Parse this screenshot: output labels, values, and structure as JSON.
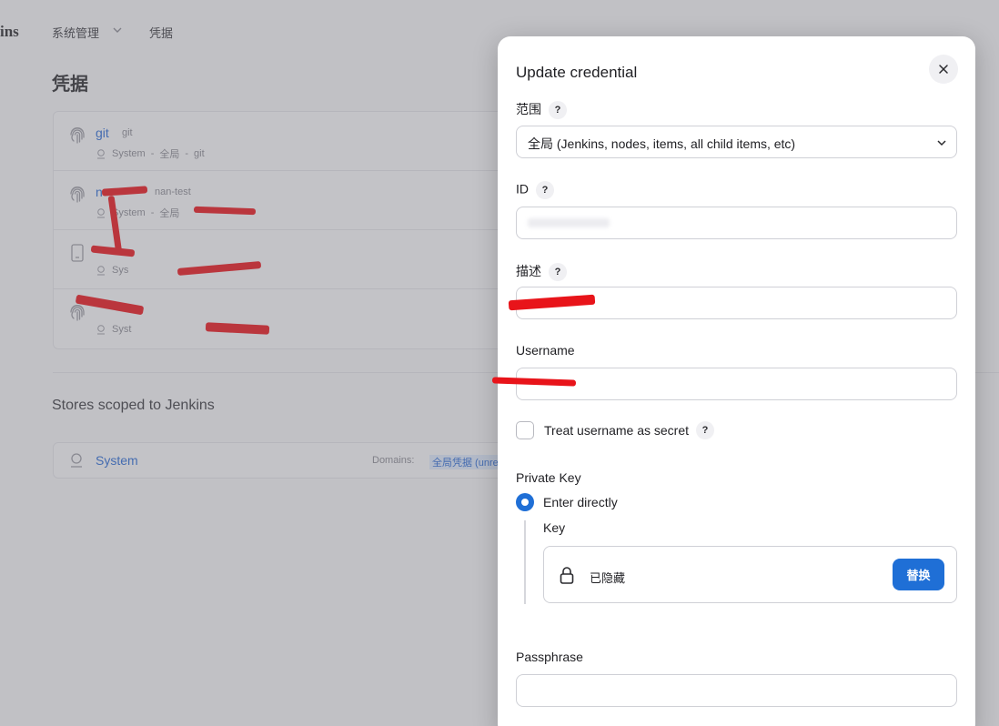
{
  "header": {
    "brand": "ins",
    "breadcrumbs": [
      "系统管理",
      "凭据"
    ]
  },
  "page": {
    "title": "凭据"
  },
  "credentials": [
    {
      "name": "git",
      "alias": "git",
      "meta_system": "System",
      "meta_scope": "全局",
      "meta_id": "git",
      "icon": "fingerprint-icon"
    },
    {
      "name": "n",
      "alias": "nan-test",
      "meta_system": "System",
      "meta_scope": "全局",
      "icon": "fingerprint-icon"
    },
    {
      "name": "",
      "alias": "",
      "meta_system": "Sys",
      "icon": "mobile-icon"
    },
    {
      "name": "",
      "alias": "",
      "meta_system": "Syst",
      "icon": "fingerprint-icon"
    }
  ],
  "stores": {
    "section_title": "Stores scoped to Jenkins",
    "rows": [
      {
        "name": "System",
        "domains_label": "Domains:",
        "domain_link": "全局凭据 (unres"
      }
    ]
  },
  "modal": {
    "title": "Update credential",
    "scope": {
      "label": "范围",
      "help": "?",
      "selected": "全局 (Jenkins, nodes, items, all child items, etc)"
    },
    "id": {
      "label": "ID",
      "help": "?",
      "value": ""
    },
    "description": {
      "label": "描述",
      "help": "?",
      "value": ""
    },
    "username": {
      "label": "Username",
      "value": ""
    },
    "treat_secret": {
      "label": "Treat username as secret",
      "help": "?",
      "checked": false
    },
    "private_key": {
      "label": "Private Key",
      "option": "Enter directly",
      "key_label": "Key",
      "hidden_text": "已隐藏",
      "replace_button": "替换"
    },
    "passphrase": {
      "label": "Passphrase",
      "value": ""
    }
  },
  "colors": {
    "accent": "#1f6fd6",
    "link": "#2c6bd4",
    "redaction": "#e8141a"
  }
}
